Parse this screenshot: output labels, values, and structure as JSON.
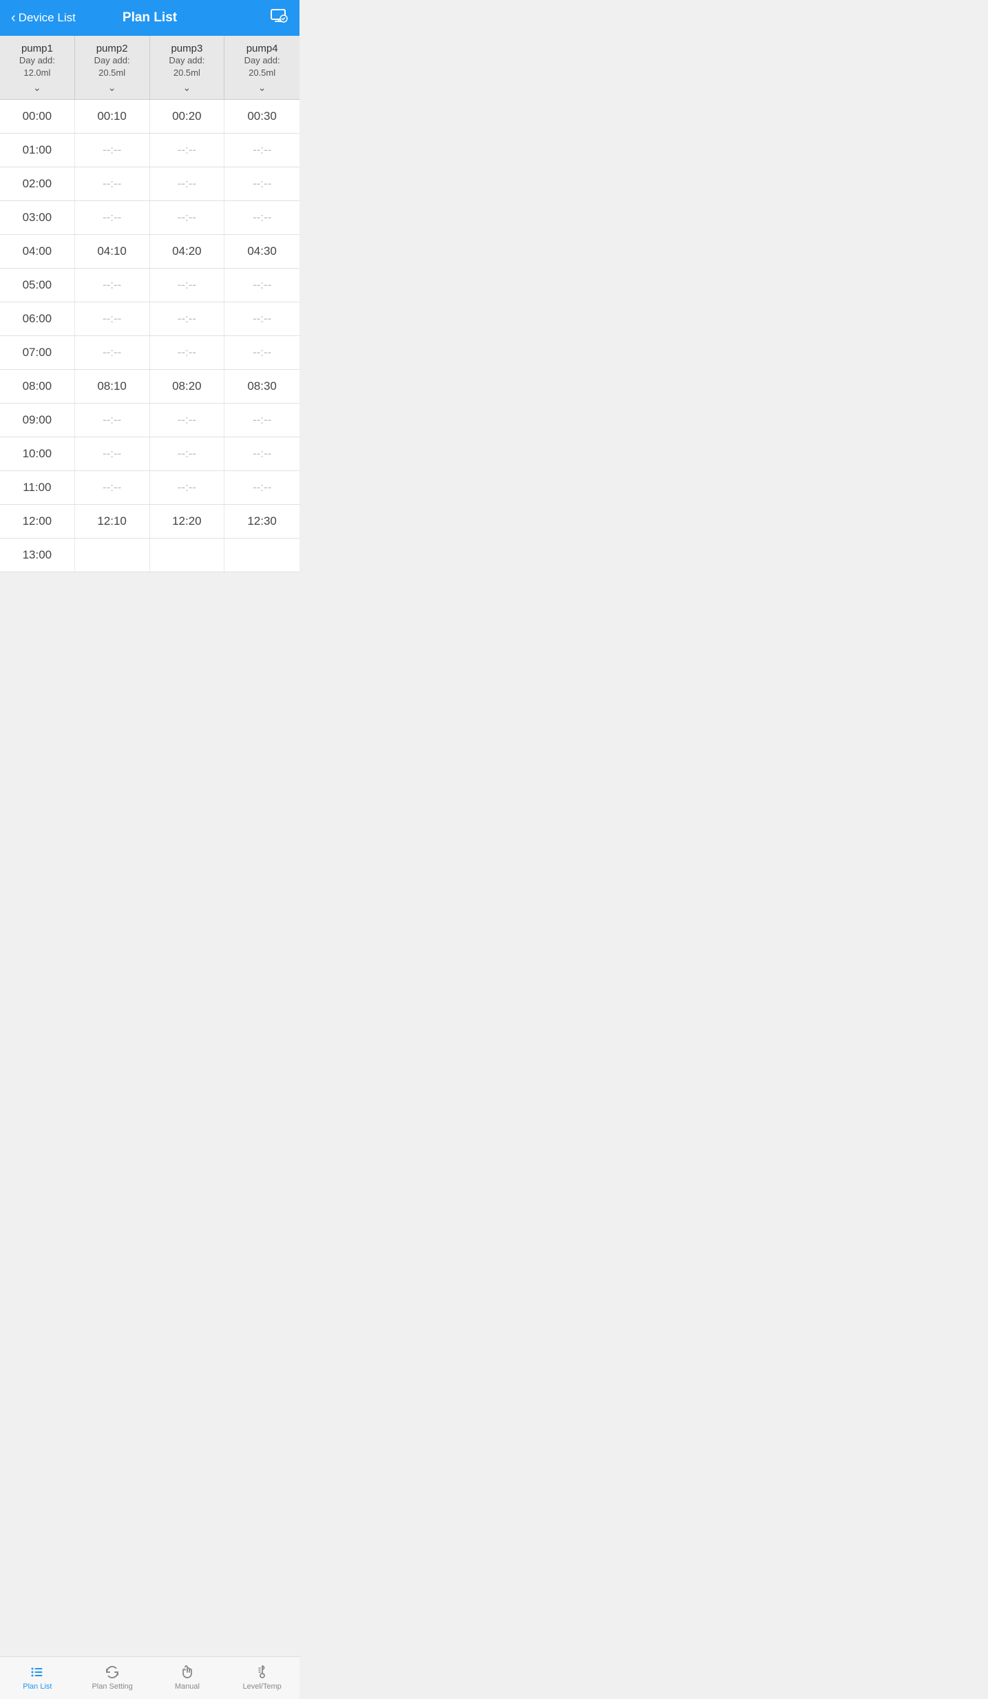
{
  "header": {
    "back_label": "Device List",
    "title": "Plan List",
    "icon": "screen-check-icon"
  },
  "columns": [
    {
      "name": "pump1",
      "sub": "Day add:\n12.0ml",
      "day_add_line1": "Day add:",
      "day_add_line2": "12.0ml"
    },
    {
      "name": "pump2",
      "sub": "Day add:\n20.5ml",
      "day_add_line1": "Day add:",
      "day_add_line2": "20.5ml"
    },
    {
      "name": "pump3",
      "sub": "Day add:\n20.5ml",
      "day_add_line1": "Day add:",
      "day_add_line2": "20.5ml"
    },
    {
      "name": "pump4",
      "sub": "Day add:\n20.5ml",
      "day_add_line1": "Day add:",
      "day_add_line2": "20.5ml"
    }
  ],
  "rows": [
    {
      "cells": [
        "00:00",
        "00:10",
        "00:20",
        "00:30"
      ]
    },
    {
      "cells": [
        "01:00",
        "--:--",
        "--:--",
        "--:--"
      ]
    },
    {
      "cells": [
        "02:00",
        "--:--",
        "--:--",
        "--:--"
      ]
    },
    {
      "cells": [
        "03:00",
        "--:--",
        "--:--",
        "--:--"
      ]
    },
    {
      "cells": [
        "04:00",
        "04:10",
        "04:20",
        "04:30"
      ]
    },
    {
      "cells": [
        "05:00",
        "--:--",
        "--:--",
        "--:--"
      ]
    },
    {
      "cells": [
        "06:00",
        "--:--",
        "--:--",
        "--:--"
      ]
    },
    {
      "cells": [
        "07:00",
        "--:--",
        "--:--",
        "--:--"
      ]
    },
    {
      "cells": [
        "08:00",
        "08:10",
        "08:20",
        "08:30"
      ]
    },
    {
      "cells": [
        "09:00",
        "--:--",
        "--:--",
        "--:--"
      ]
    },
    {
      "cells": [
        "10:00",
        "--:--",
        "--:--",
        "--:--"
      ]
    },
    {
      "cells": [
        "11:00",
        "--:--",
        "--:--",
        "--:--"
      ]
    },
    {
      "cells": [
        "12:00",
        "12:10",
        "12:20",
        "12:30"
      ]
    },
    {
      "cells": [
        "13:00",
        "",
        "",
        ""
      ]
    }
  ],
  "bottom_nav": [
    {
      "id": "plan-list",
      "label": "Plan List",
      "active": true
    },
    {
      "id": "plan-setting",
      "label": "Plan Setting",
      "active": false
    },
    {
      "id": "manual",
      "label": "Manual",
      "active": false
    },
    {
      "id": "level-temp",
      "label": "Level/Temp",
      "active": false
    }
  ]
}
